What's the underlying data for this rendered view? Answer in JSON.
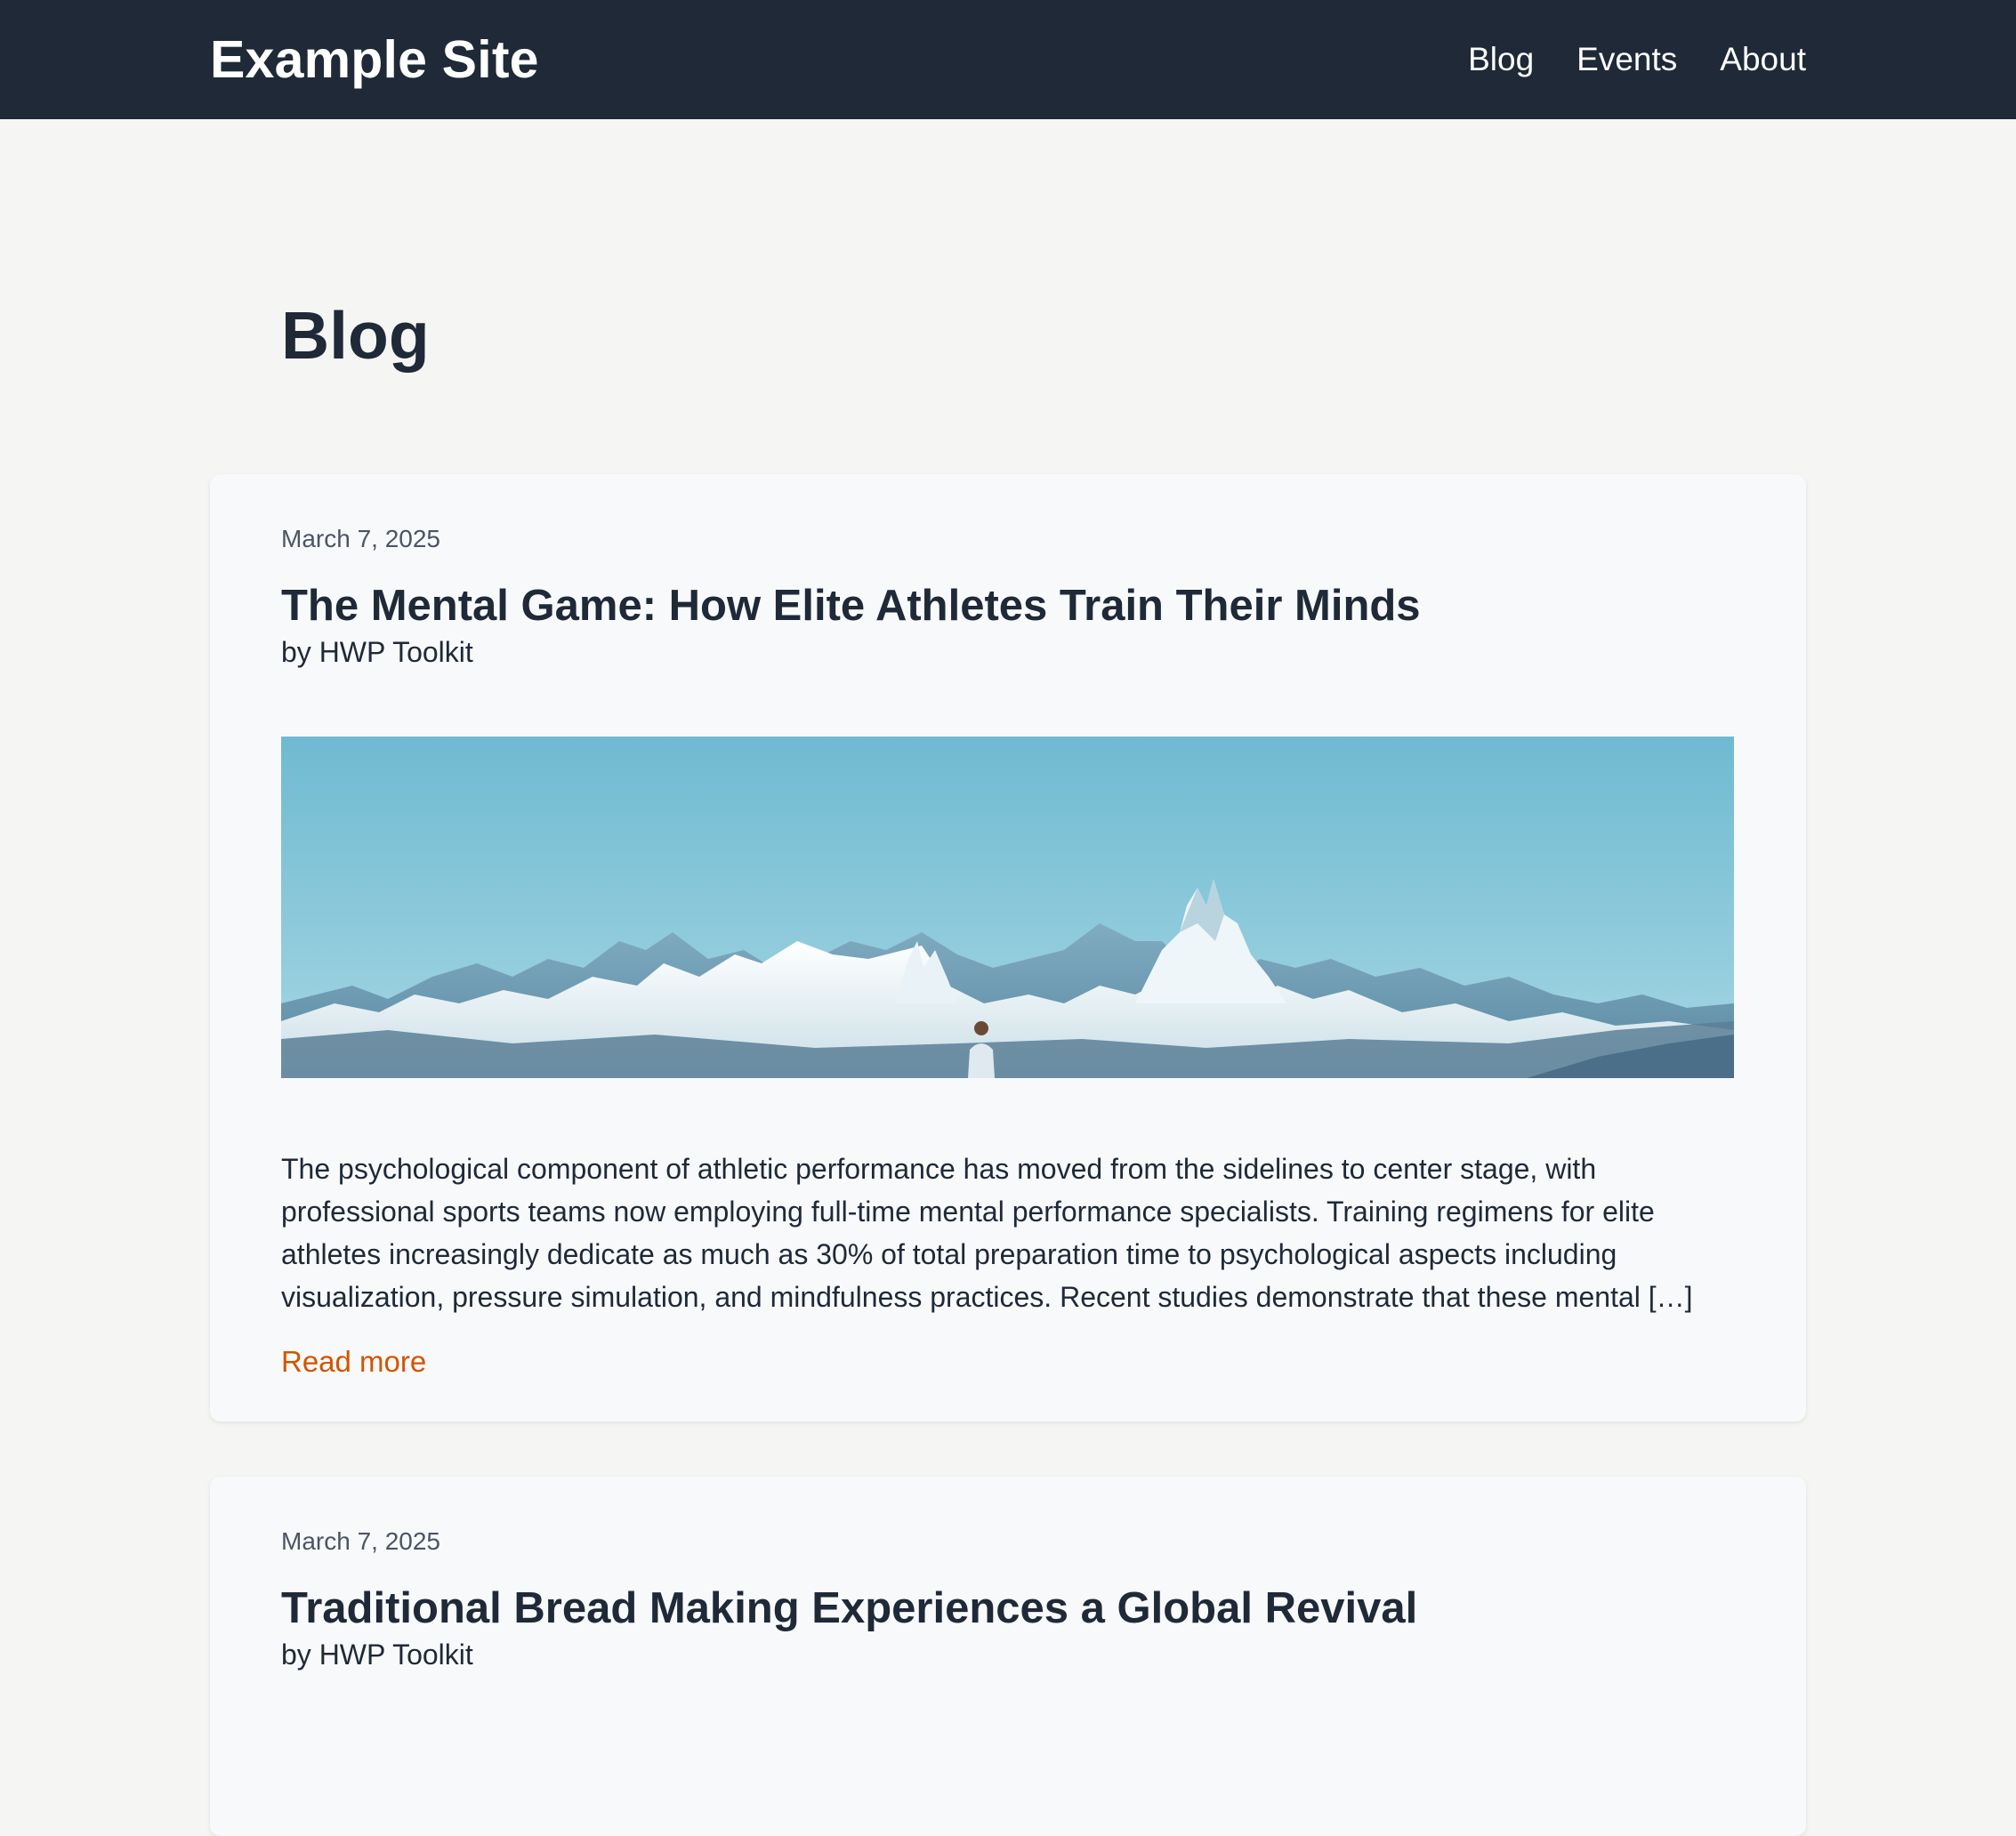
{
  "site": {
    "title": "Example Site",
    "nav": [
      "Blog",
      "Events",
      "About"
    ]
  },
  "page": {
    "title": "Blog"
  },
  "posts": [
    {
      "date": "March 7, 2025",
      "title": "The Mental Game: How Elite Athletes Train Their Minds",
      "author": "by HWP Toolkit",
      "image": "mountain-landscape-image",
      "excerpt": "The psychological component of athletic performance has moved from the sidelines to center stage, with professional sports teams now employing full-time mental performance specialists. Training regimens for elite athletes increasingly dedicate as much as 30% of total preparation time to psychological aspects including visualization, pressure simulation, and mindfulness practices. Recent studies demonstrate that these mental […]",
      "read_more": "Read more"
    },
    {
      "date": "March 7, 2025",
      "title": "Traditional Bread Making Experiences a Global Revival",
      "author": "by HWP Toolkit"
    }
  ],
  "colors": {
    "header_bg": "#1f2937",
    "page_bg": "#f5f5f3",
    "card_bg": "#f8f9fb",
    "link_accent": "#d35400"
  }
}
